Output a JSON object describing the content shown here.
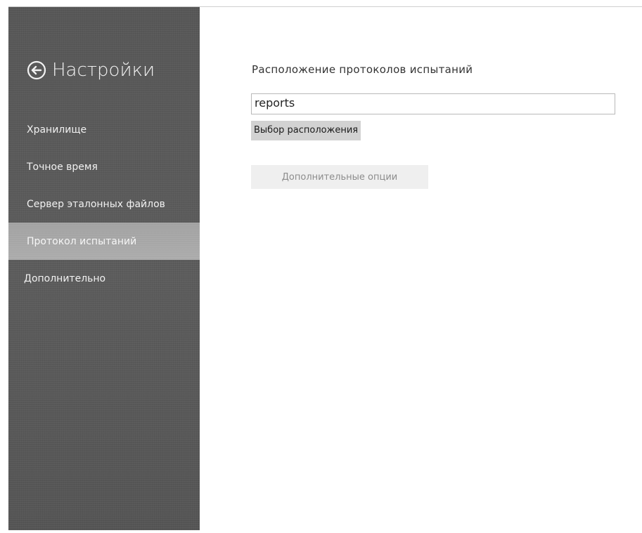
{
  "sidebar": {
    "back_icon": "back-arrow-circle-icon",
    "title": "Настройки",
    "items": [
      {
        "label": "Хранилище",
        "selected": false
      },
      {
        "label": "Точное время",
        "selected": false
      },
      {
        "label": "Сервер эталонных файлов",
        "selected": false
      },
      {
        "label": "Протокол испытаний",
        "selected": true
      },
      {
        "label": "Дополнительно",
        "selected": false
      }
    ]
  },
  "main": {
    "section_label": "Расположение протоколов испытаний",
    "path_value": "reports",
    "choose_button_label": "Выбор расположения",
    "extra_button_label": "Дополнительные опции"
  },
  "colors": {
    "sidebar_bg": "#5a5a5a",
    "selected_item_bg": "#a6a6a6",
    "content_bg": "#ffffff"
  }
}
